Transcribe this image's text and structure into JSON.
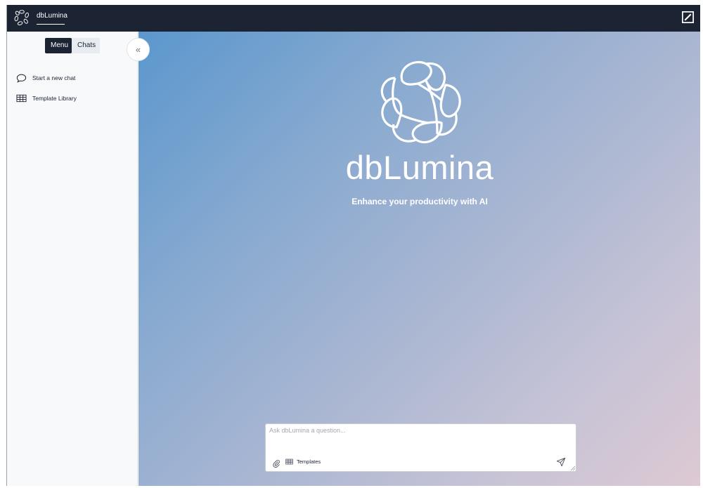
{
  "topbar": {
    "app_name": "dbLumina",
    "logo_icon": "lumina-logo-icon",
    "brand_icon": "deutsche-bank-logo-icon",
    "background": "#1c2434"
  },
  "sidebar": {
    "tabs": [
      {
        "label": "Menu",
        "active": true
      },
      {
        "label": "Chats",
        "active": false
      }
    ],
    "items": [
      {
        "label": "Start a new chat",
        "icon": "chat-bubble-icon"
      },
      {
        "label": "Template Library",
        "icon": "table-grid-icon"
      }
    ],
    "collapse_icon": "double-chevron-left-icon"
  },
  "main": {
    "title": "dbLumina",
    "subtitle": "Enhance your productivity with AI",
    "gradient": [
      "#5b97cd",
      "#a9b6d2",
      "#ddc9d3"
    ]
  },
  "composer": {
    "placeholder": "Ask dbLumina a question...",
    "value": "",
    "templates_label": "Templates",
    "attach_icon": "paperclip-icon",
    "templates_icon": "table-grid-icon",
    "send_icon": "send-icon"
  }
}
